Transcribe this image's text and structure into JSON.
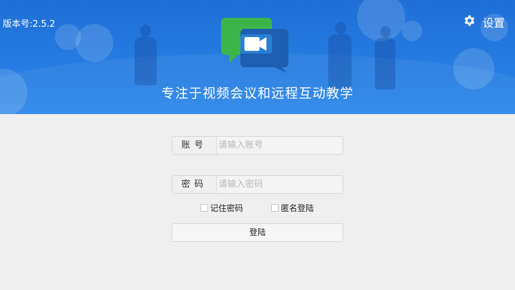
{
  "header": {
    "version": "版本号:2.5.2",
    "settings_label": "设置",
    "settings_icon": "gear-icon",
    "slogan": "专注于视频会议和远程互动教学",
    "logo_icon": "video-camera-chat-icon",
    "colors": {
      "banner_top": "#1f6fd6",
      "banner_bottom": "#2a86e8",
      "logo_green": "#3bb54a",
      "logo_blue": "#1d5fb0"
    }
  },
  "form": {
    "account_label": "账号",
    "account_placeholder": "请输入账号",
    "account_value": "",
    "password_label": "密码",
    "password_placeholder": "请输入密码",
    "password_value": "",
    "remember_label": "记住密码",
    "remember_checked": false,
    "anonymous_label": "匿名登陆",
    "anonymous_checked": false,
    "login_label": "登陆"
  }
}
